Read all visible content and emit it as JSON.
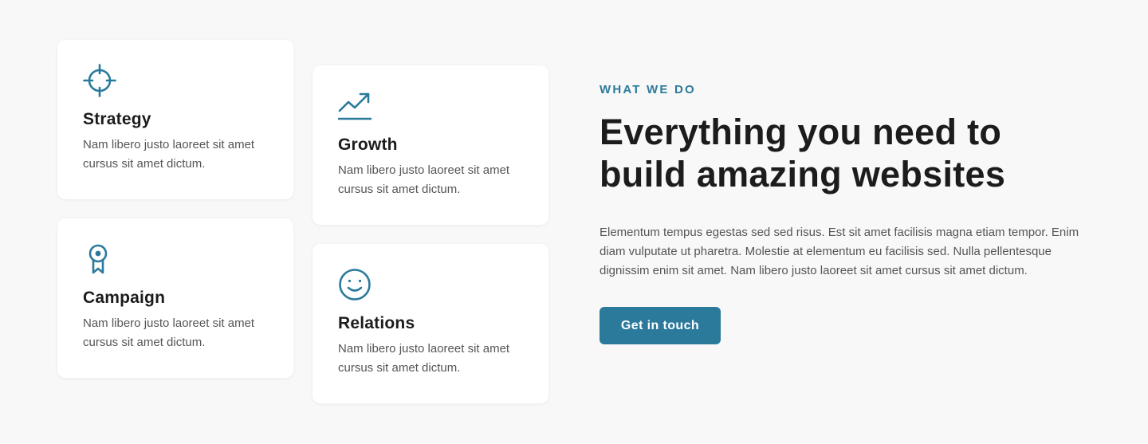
{
  "colors": {
    "accent": "#2b7a9c",
    "background": "#f8f8f8",
    "card": "#ffffff",
    "heading": "#1c1c1c",
    "body": "#555555"
  },
  "cards": [
    {
      "icon": "crosshair-target-icon",
      "title": "Strategy",
      "text": "Nam libero justo laoreet sit amet cursus sit amet dictum."
    },
    {
      "icon": "trending-up-chart-icon",
      "title": "Growth",
      "text": "Nam libero justo laoreet sit amet cursus sit amet dictum."
    },
    {
      "icon": "award-ribbon-icon",
      "title": "Campaign",
      "text": "Nam libero justo laoreet sit amet cursus sit amet dictum."
    },
    {
      "icon": "smiley-face-icon",
      "title": "Relations",
      "text": "Nam libero justo laoreet sit amet cursus sit amet dictum."
    }
  ],
  "content": {
    "eyebrow": "WHAT WE DO",
    "headline": "Everything you need to build amazing websites",
    "body": "Elementum tempus egestas sed sed risus. Est sit amet facilisis magna etiam tempor. Enim diam vulputate ut pharetra. Molestie at elementum eu facilisis sed. Nulla pellentesque dignissim enim sit amet. Nam libero justo laoreet sit amet cursus sit amet dictum.",
    "cta_label": "Get in touch"
  }
}
